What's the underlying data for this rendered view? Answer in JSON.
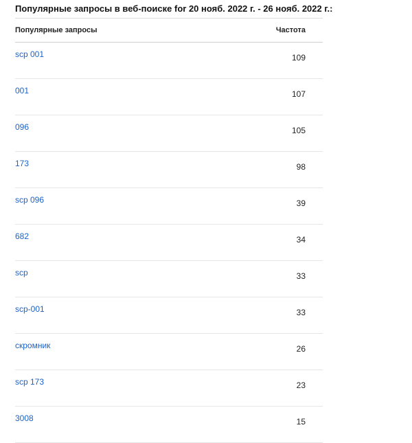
{
  "title": "Популярные запросы в веб-поиске for 20 нояб. 2022 г. - 26 нояб. 2022 г.:",
  "table": {
    "headers": {
      "query": "Популярные запросы",
      "frequency": "Частота"
    },
    "rows": [
      {
        "query": "scp 001",
        "frequency": "109"
      },
      {
        "query": "001",
        "frequency": "107"
      },
      {
        "query": "096",
        "frequency": "105"
      },
      {
        "query": "173",
        "frequency": "98"
      },
      {
        "query": "scp 096",
        "frequency": "39"
      },
      {
        "query": "682",
        "frequency": "34"
      },
      {
        "query": "scp",
        "frequency": "33"
      },
      {
        "query": "scp-001",
        "frequency": "33"
      },
      {
        "query": "скромник",
        "frequency": "26"
      },
      {
        "query": "scp 173",
        "frequency": "23"
      },
      {
        "query": "3008",
        "frequency": "15"
      }
    ]
  },
  "colors": {
    "link": "#1a62c8",
    "text": "#222222",
    "divider": "#e6e6e6"
  }
}
